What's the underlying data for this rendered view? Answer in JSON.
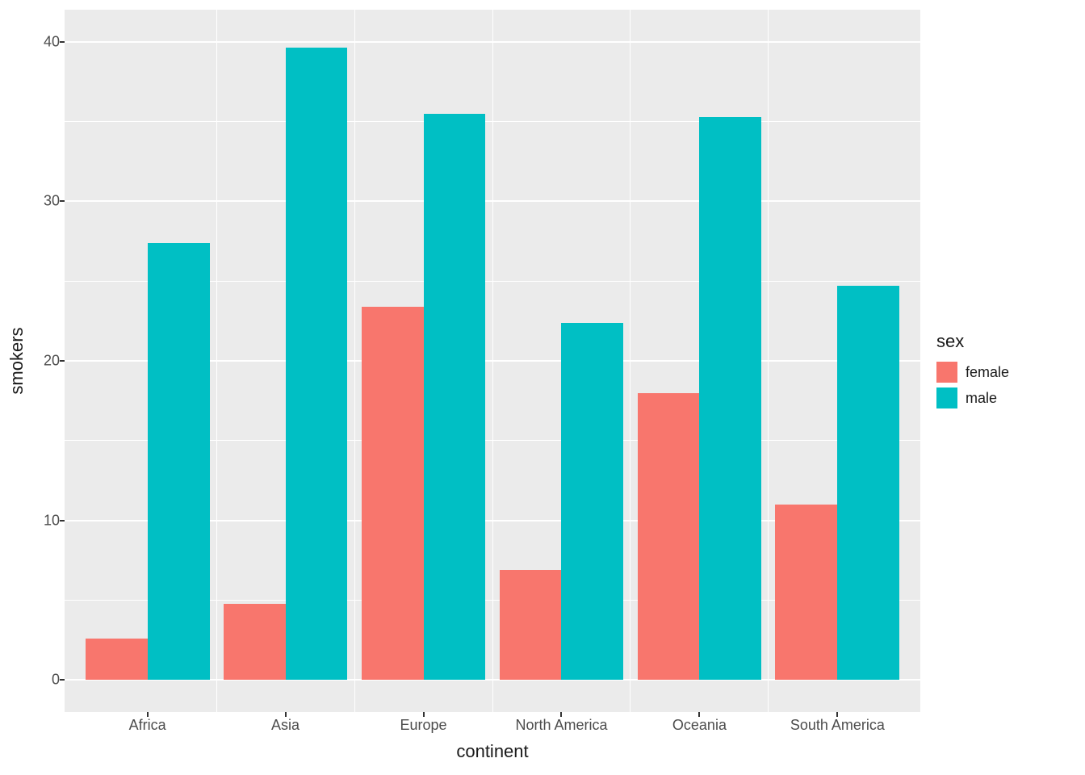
{
  "chart_data": {
    "type": "bar",
    "categories": [
      "Africa",
      "Asia",
      "Europe",
      "North America",
      "Oceania",
      "South America"
    ],
    "series": [
      {
        "name": "female",
        "values": [
          2.6,
          4.8,
          23.4,
          6.9,
          18.0,
          11.0
        ]
      },
      {
        "name": "male",
        "values": [
          27.4,
          39.6,
          35.5,
          22.4,
          35.3,
          24.7
        ]
      }
    ],
    "xlabel": "continent",
    "ylabel": "smokers",
    "ylim": [
      0,
      40
    ],
    "y_ticks": [
      0,
      10,
      20,
      30,
      40
    ],
    "legend_title": "sex",
    "legend_position": "right",
    "grid": true,
    "colors": {
      "female": "#f8766d",
      "male": "#00bfc4"
    }
  },
  "y_ticks": {
    "t0": "0",
    "t1": "10",
    "t2": "20",
    "t3": "30",
    "t4": "40"
  },
  "x_ticks": {
    "c0": "Africa",
    "c1": "Asia",
    "c2": "Europe",
    "c3": "North America",
    "c4": "Oceania",
    "c5": "South America"
  },
  "axis": {
    "x": "continent",
    "y": "smokers"
  },
  "legend": {
    "title": "sex",
    "female": "female",
    "male": "male"
  }
}
